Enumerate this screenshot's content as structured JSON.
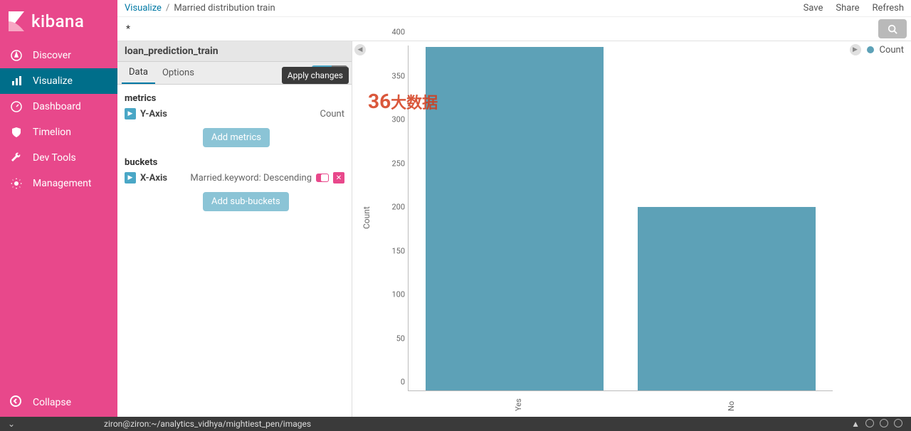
{
  "brand": "kibana",
  "sidebar": {
    "items": [
      {
        "label": "Discover",
        "icon": "compass-icon"
      },
      {
        "label": "Visualize",
        "icon": "bar-chart-icon"
      },
      {
        "label": "Dashboard",
        "icon": "gauge-icon"
      },
      {
        "label": "Timelion",
        "icon": "shield-icon"
      },
      {
        "label": "Dev Tools",
        "icon": "wrench-icon"
      },
      {
        "label": "Management",
        "icon": "gear-icon"
      }
    ],
    "active": 1,
    "collapse_label": "Collapse"
  },
  "breadcrumb": {
    "root": "Visualize",
    "current": "Married distribution train"
  },
  "top_actions": {
    "save": "Save",
    "share": "Share",
    "refresh": "Refresh"
  },
  "search": {
    "value": "*"
  },
  "editor": {
    "index_title": "loan_prediction_train",
    "tabs": {
      "data": "Data",
      "options": "Options"
    },
    "tooltip": "Apply changes",
    "metrics_title": "metrics",
    "yaxis": {
      "label": "Y-Axis",
      "value": "Count"
    },
    "add_metrics": "Add metrics",
    "buckets_title": "buckets",
    "xaxis": {
      "label": "X-Axis",
      "value": "Married.keyword: Descending"
    },
    "add_sub_buckets": "Add sub-buckets"
  },
  "chart_data": {
    "type": "bar",
    "categories": [
      "Yes",
      "No"
    ],
    "values": [
      398,
      213
    ],
    "title": "",
    "xlabel": "",
    "ylabel": "Count",
    "ylim": [
      0,
      400
    ],
    "yticks": [
      0,
      50,
      100,
      150,
      200,
      250,
      300,
      350,
      400
    ],
    "legend": [
      "Count"
    ]
  },
  "watermark": {
    "num": "36",
    "text": "大数据"
  },
  "terminal": {
    "text": "ziron@ziron:~/analytics_vidhya/mightiest_pen/images"
  }
}
